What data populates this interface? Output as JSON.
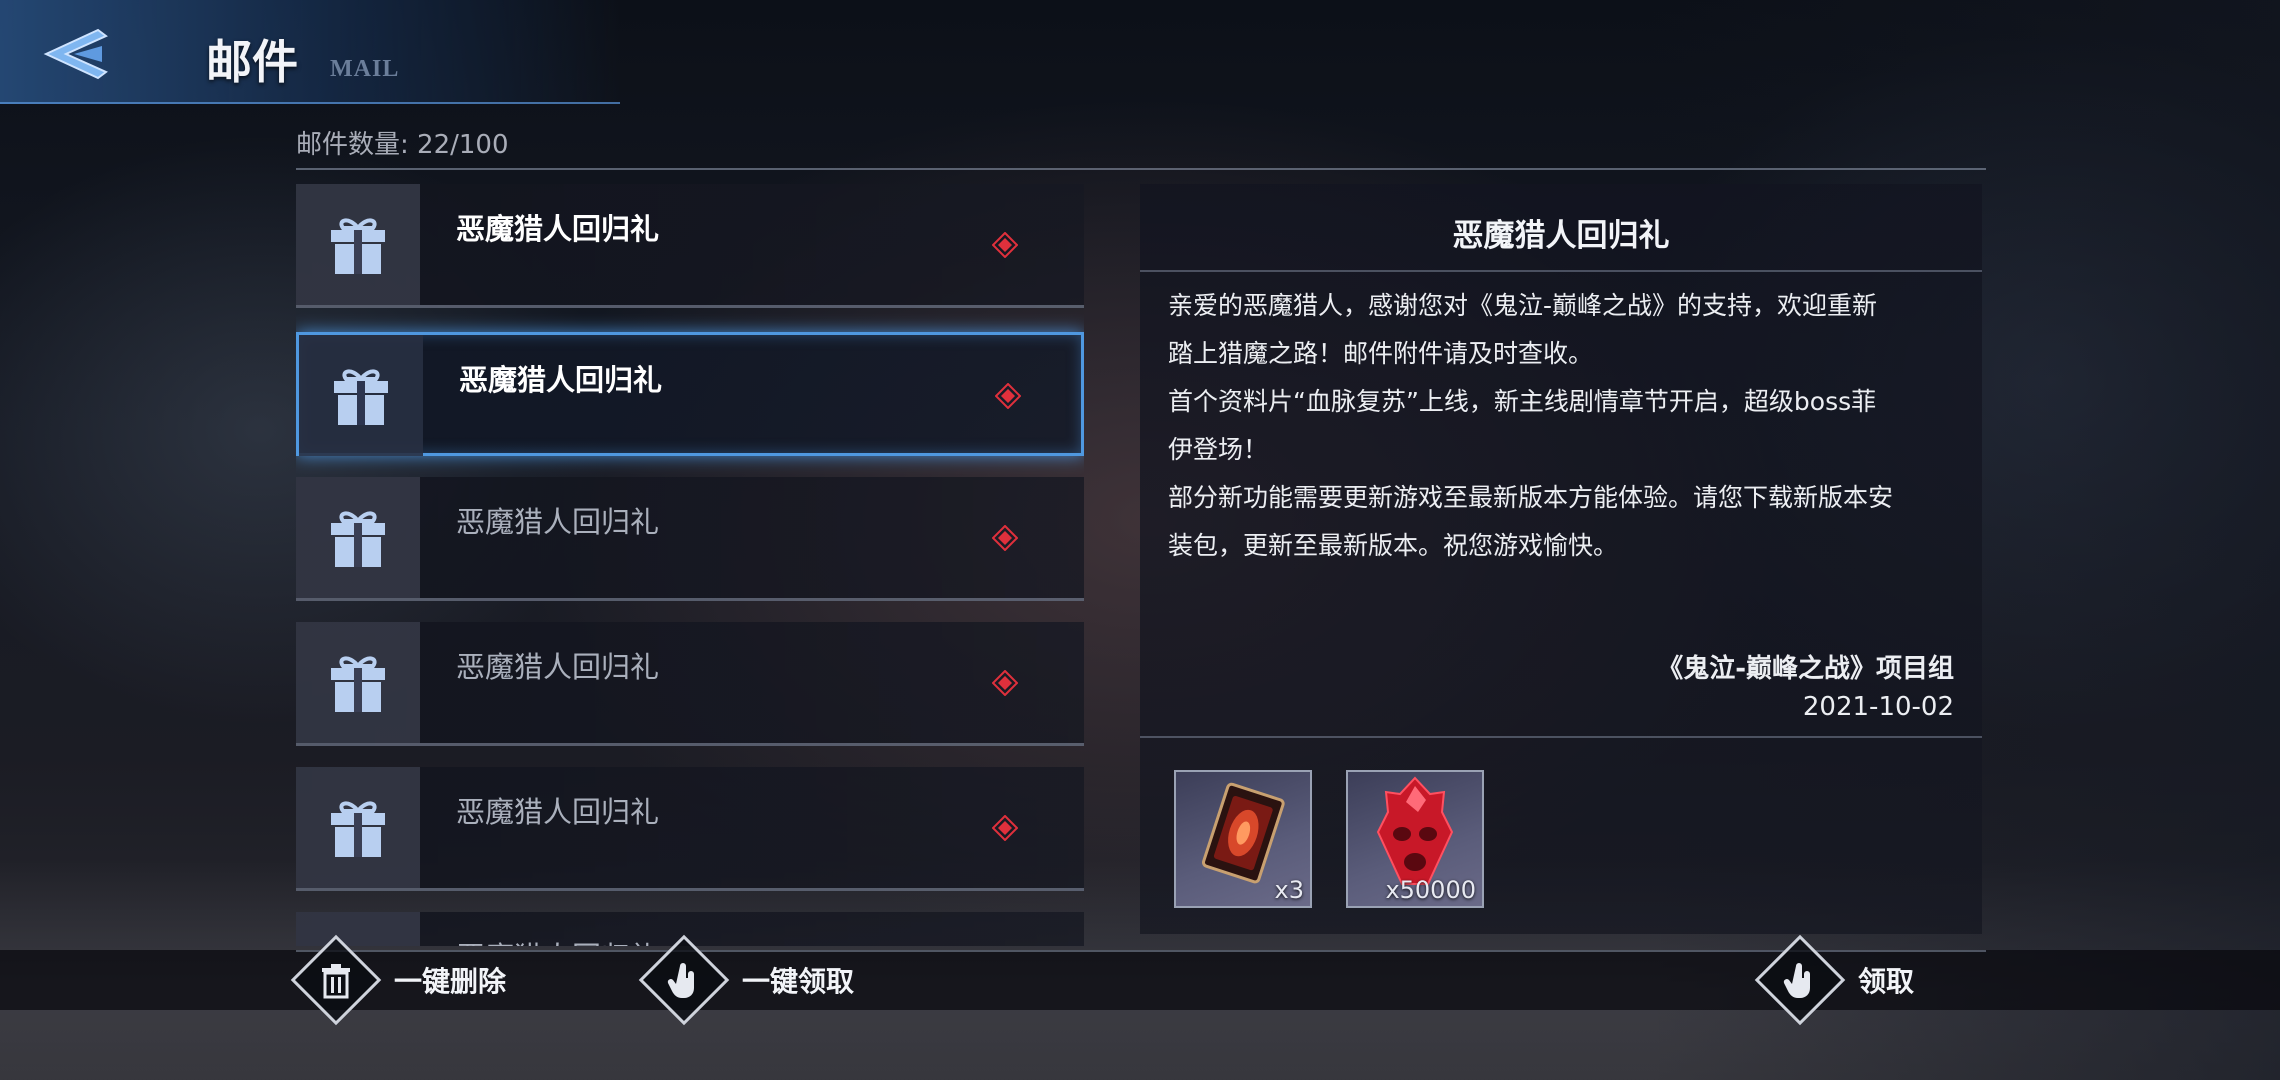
{
  "header": {
    "title": "邮件",
    "subtitle": "MAIL",
    "back_icon": "back-arrow-icon"
  },
  "mail_count": "邮件数量: 22/100",
  "mails": [
    {
      "title": "恶魔猎人回归礼",
      "state": "unread"
    },
    {
      "title": "恶魔猎人回归礼",
      "state": "selected"
    },
    {
      "title": "恶魔猎人回归礼",
      "state": "read"
    },
    {
      "title": "恶魔猎人回归礼",
      "state": "read"
    },
    {
      "title": "恶魔猎人回归礼",
      "state": "read"
    },
    {
      "title": "恶魔猎人回归礼",
      "state": "read"
    }
  ],
  "detail": {
    "title": "恶魔猎人回归礼",
    "body_lines": [
      "亲爱的恶魔猎人，感谢您对《鬼泣-巅峰之战》的支持，欢迎重新",
      "踏上猎魔之路！邮件附件请及时查收。",
      "首个资料片“血脉复苏”上线，新主线剧情章节开启，超级boss菲",
      "伊登场！",
      "部分新功能需要更新游戏至最新版本方能体验。请您下载新版本安",
      "装包，更新至最新版本。祝您游戏愉快。"
    ],
    "signature": "《鬼泣-巅峰之战》项目组",
    "date": "2021-10-02",
    "attachments": [
      {
        "item": "card-item-icon",
        "count": "x3"
      },
      {
        "item": "red-crystal-icon",
        "count": "x50000"
      }
    ]
  },
  "actions": {
    "delete_all": "一键删除",
    "claim_all": "一键领取",
    "claim": "领取"
  },
  "colors": {
    "accent": "#4f98e0",
    "unread_marker": "#e0303c",
    "gift_icon": "#b8cff0"
  }
}
